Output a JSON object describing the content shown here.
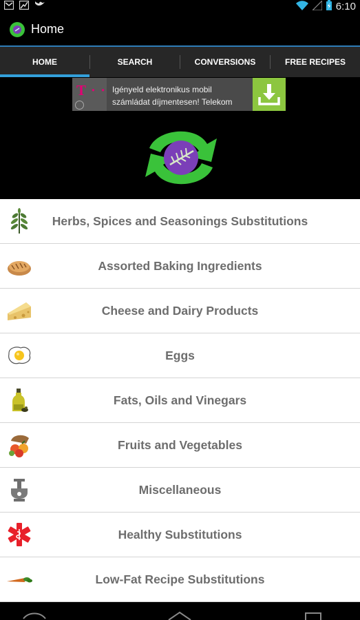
{
  "status_bar": {
    "time": "6:10",
    "icons": [
      "gmail-icon",
      "stocks-icon",
      "bird-icon",
      "wifi-icon",
      "signal-icon",
      "battery-icon"
    ]
  },
  "action_bar": {
    "title": "Home",
    "app_icon": "app-logo-icon"
  },
  "tabs": [
    {
      "label": "HOME",
      "selected": true
    },
    {
      "label": "SEARCH",
      "selected": false
    },
    {
      "label": "CONVERSIONS",
      "selected": false
    },
    {
      "label": "FREE RECIPES",
      "selected": false
    }
  ],
  "ad": {
    "brand_mark": "T · ·",
    "line1": "Igényeld elektronikus mobil",
    "line2": "számládat díjmentesen! Telekom",
    "download_icon": "download-icon"
  },
  "categories": [
    {
      "label": "Herbs, Spices and Seasonings Substitutions",
      "icon": "herb-sprig-icon"
    },
    {
      "label": "Assorted Baking Ingredients",
      "icon": "bread-icon"
    },
    {
      "label": "Cheese and Dairy Products",
      "icon": "cheese-icon"
    },
    {
      "label": "Eggs",
      "icon": "fried-egg-icon"
    },
    {
      "label": "Fats, Oils and Vinegars",
      "icon": "oil-bottle-icon"
    },
    {
      "label": "Fruits and Vegetables",
      "icon": "fruit-basket-icon"
    },
    {
      "label": "Miscellaneous",
      "icon": "mortar-pestle-icon"
    },
    {
      "label": "Healthy Substitutions",
      "icon": "medical-star-icon"
    },
    {
      "label": "Low-Fat Recipe Substitutions",
      "icon": "carrot-icon"
    }
  ],
  "colors": {
    "tab_indicator": "#33a0db",
    "ad_accent": "#e20074",
    "ad_download": "#8cc63f",
    "logo_green": "#3ac23a",
    "logo_purple": "#7b3fb8",
    "label_gray": "#6d6d6d"
  }
}
